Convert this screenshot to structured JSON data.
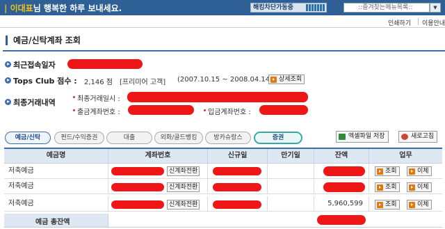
{
  "topbar": {
    "user_name": "이대표",
    "greeting": "님 행복한 하루 보내세요.",
    "security_status": "해킹차단가동중",
    "favorites_placeholder": "::즐겨찾는메뉴목록::",
    "favorites_arrow": "▼"
  },
  "util": {
    "print_label": "인쇄하기",
    "guide_label": "이용안내"
  },
  "page": {
    "title": "예금/신탁계좌 조회"
  },
  "info": {
    "recent_access_label": "최근접속일자",
    "tops_label": "Tops Club 점수 :",
    "tops_score": "2,146 점",
    "tops_grade": "[프리미어 고객]",
    "tops_period": "(2007.10.15 ~ 2008.04.14)",
    "detail_button": "상세조회",
    "last_tx_label": "최종거래내역",
    "last_tx_datetime_label": "최종거래일시 :",
    "withdraw_account_label": "출금계좌번호 :",
    "deposit_account_label": "입금계좌번호 :"
  },
  "tabs": [
    {
      "label": "예금/신탁"
    },
    {
      "label": "펀드/수익증권"
    },
    {
      "label": "대출"
    },
    {
      "label": "외화/골드뱅킹"
    },
    {
      "label": "방카슈랑스"
    },
    {
      "label": "증권"
    }
  ],
  "toolbar": {
    "excel_label": "엑셀파일 저장",
    "refresh_label": "새로고침"
  },
  "table": {
    "headers": [
      "예금명",
      "계좌번호",
      "신규일",
      "만기일",
      "잔액",
      "업무"
    ],
    "rows": [
      {
        "name": "저축예금",
        "convert": "신계좌전환",
        "balance": "",
        "view": "조회",
        "transfer": "이체"
      },
      {
        "name": "저축예금",
        "convert": "신계좌전환",
        "balance": "",
        "view": "조회",
        "transfer": "이체"
      },
      {
        "name": "저축예금",
        "convert": "신계좌전환",
        "balance": "5,960,599",
        "view": "조회",
        "transfer": "이체"
      }
    ],
    "total_label": "예금 총잔액"
  },
  "colors": {
    "header_bg": "#2e5f95",
    "accent": "#3a6ea5",
    "redaction": "#ee1616",
    "table_header": "#dde8f3"
  }
}
